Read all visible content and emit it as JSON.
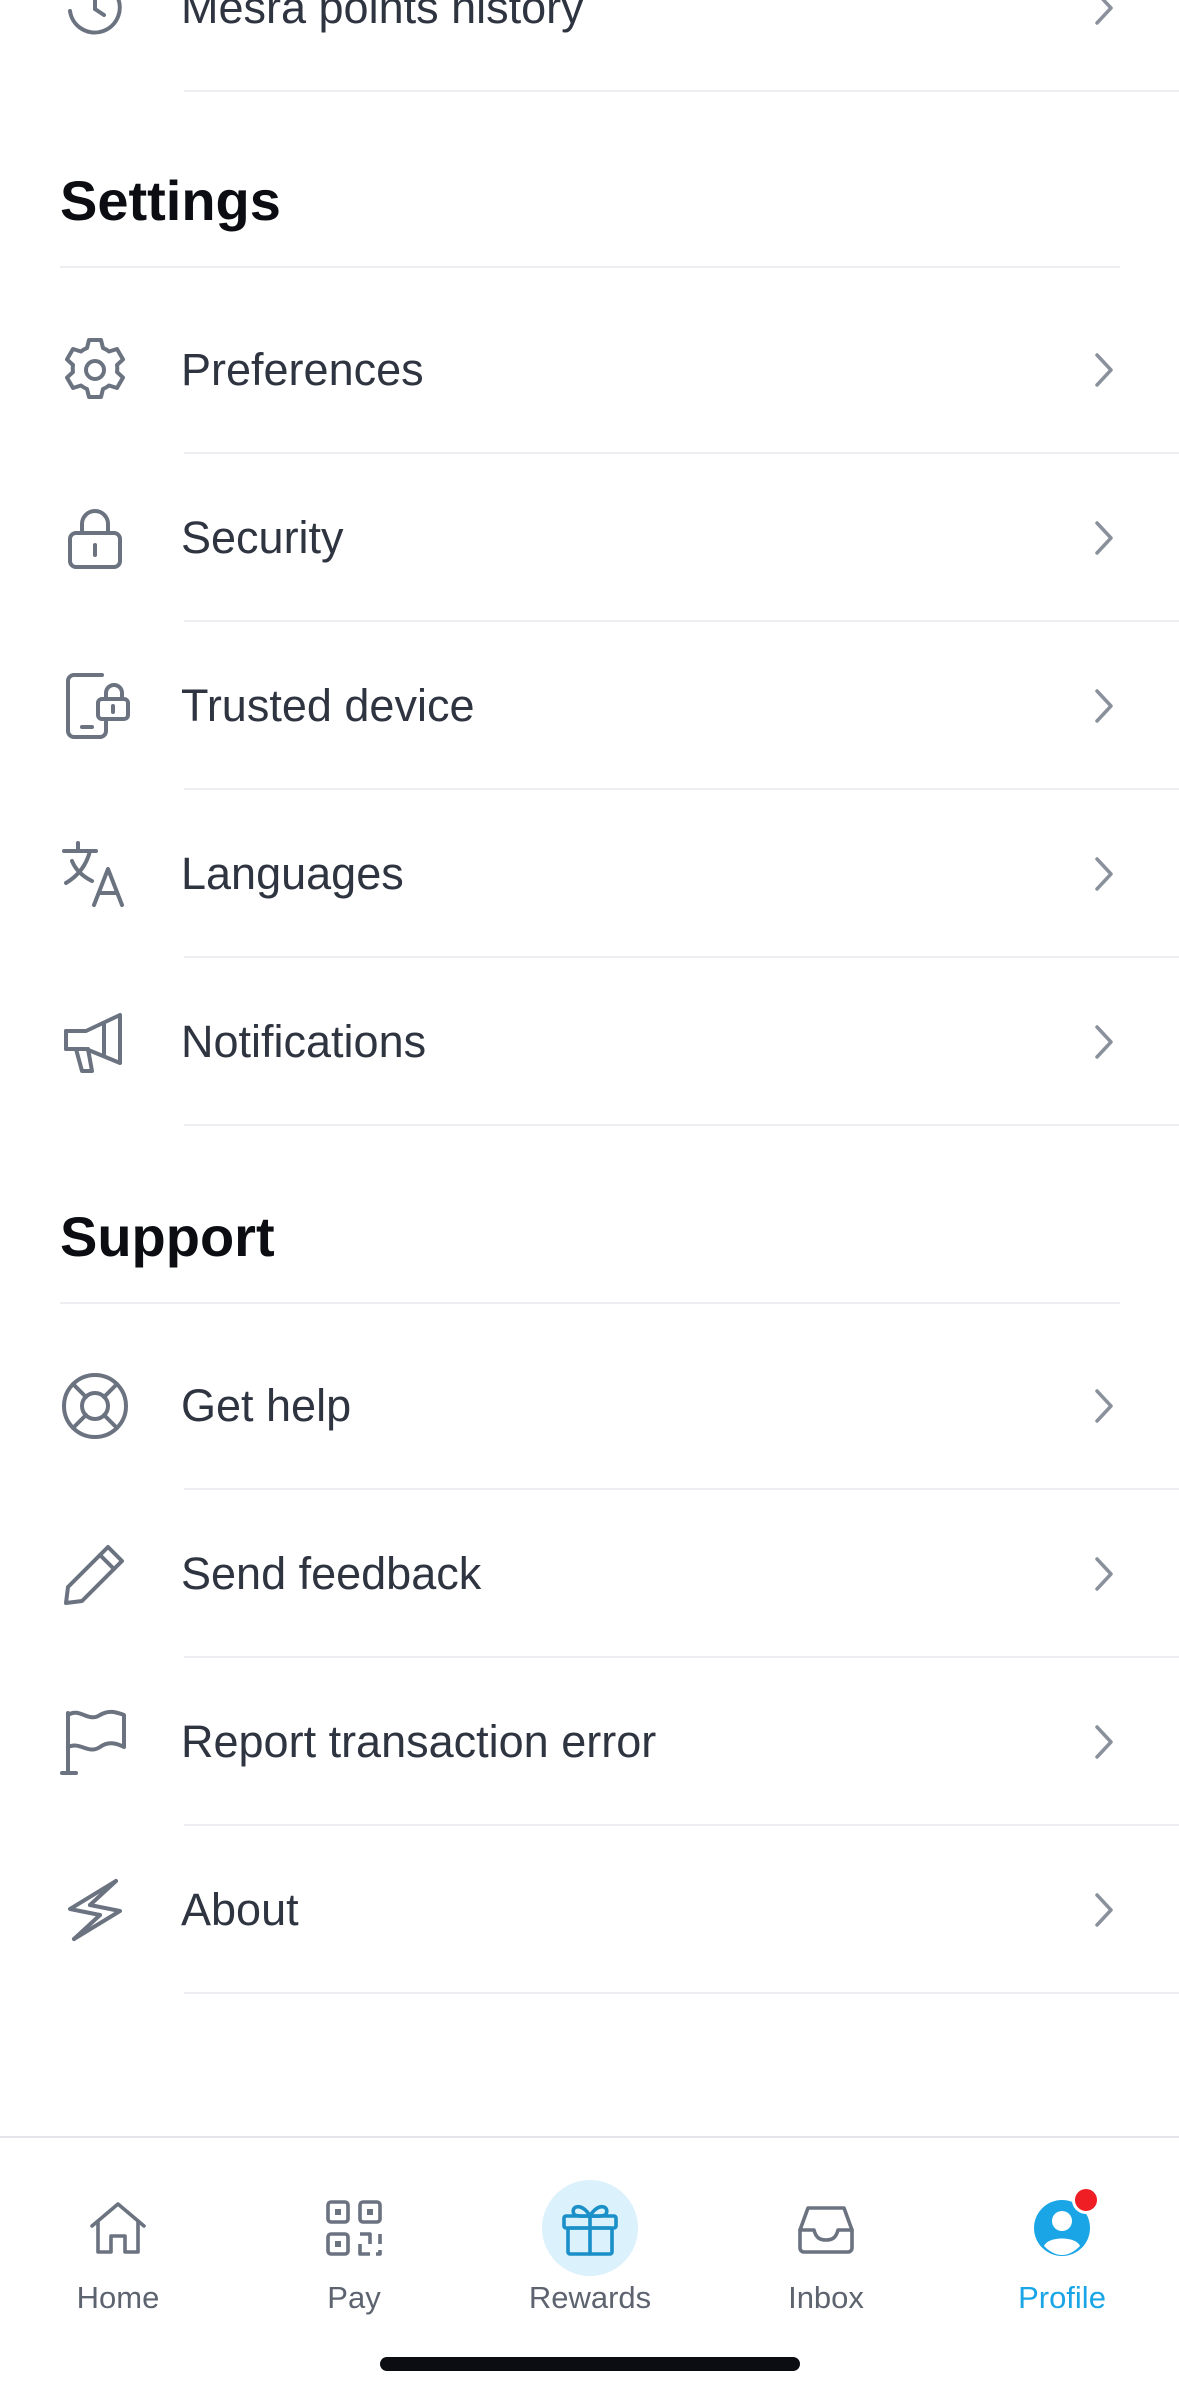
{
  "top_partial_item": {
    "label": "Mesra points history",
    "icon": "history-icon"
  },
  "settings": {
    "title": "Settings",
    "items": [
      {
        "label": "Preferences",
        "icon": "gear-icon"
      },
      {
        "label": "Security",
        "icon": "lock-icon"
      },
      {
        "label": "Trusted device",
        "icon": "trusted-device-icon"
      },
      {
        "label": "Languages",
        "icon": "translate-icon"
      },
      {
        "label": "Notifications",
        "icon": "megaphone-icon"
      }
    ]
  },
  "support": {
    "title": "Support",
    "items": [
      {
        "label": "Get help",
        "icon": "lifebuoy-icon"
      },
      {
        "label": "Send feedback",
        "icon": "pencil-icon"
      },
      {
        "label": "Report transaction error",
        "icon": "flag-icon"
      },
      {
        "label": "About",
        "icon": "about-logo-icon"
      }
    ]
  },
  "bottom_nav": {
    "items": [
      {
        "label": "Home",
        "icon": "home-icon",
        "active": false
      },
      {
        "label": "Pay",
        "icon": "qr-code-icon",
        "active": false
      },
      {
        "label": "Rewards",
        "icon": "gift-icon",
        "active": false
      },
      {
        "label": "Inbox",
        "icon": "inbox-icon",
        "active": false
      },
      {
        "label": "Profile",
        "icon": "profile-icon",
        "active": true,
        "badge": true
      }
    ]
  },
  "colors": {
    "icon_gray": "#6b7280",
    "text": "#2f3441",
    "heading": "#0b0d12",
    "chevron": "#8a919c",
    "accent": "#1aa6e6",
    "accent_soft": "#dbf1fb",
    "badge": "#ef1d24",
    "divider": "#eceef2"
  }
}
